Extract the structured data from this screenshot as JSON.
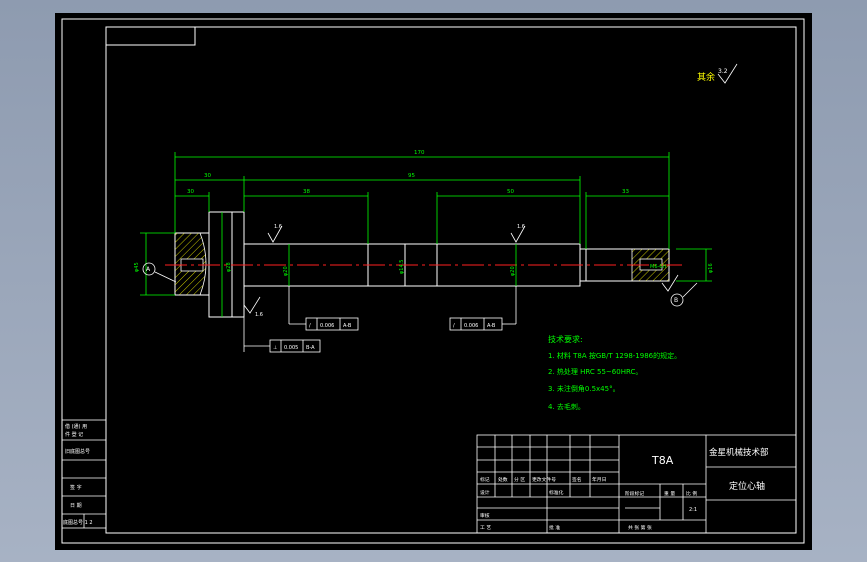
{
  "colors": {
    "background": "#8e9bb0",
    "paper": "#000000",
    "frame": "#ffffff",
    "geometry": "#ffffff",
    "dimension": "#00ff00",
    "centerline": "#ff2020",
    "hatch": "#ffff00",
    "text": "#ffffff",
    "annotation_text": "#00ff00"
  },
  "dimensions": {
    "overall_length": "170",
    "left_end": "30",
    "left_journal": "38",
    "middle_span": "95",
    "right_journal": "50",
    "right_end": "33"
  },
  "annotations": {
    "surface_finish_rest": "其余",
    "roughness_a": "3.2",
    "roughness_b": "1.6",
    "roughness_c": "1.6",
    "roughness_d": "1.6",
    "tolerance_1_value": "0.006",
    "tolerance_1_datum": "A-B",
    "tolerance_2_value": "0.006",
    "tolerance_2_datum": "A-B",
    "tolerance_3_value": "0.005",
    "tolerance_3_datum": "B-A",
    "datum_a": "A",
    "datum_b": "B",
    "dia_left": "φ45",
    "dia_flange": "φ28",
    "dia_journal_1": "φ20",
    "dia_mid": "φ14.5",
    "dia_journal_2": "φ20",
    "dia_end": "φ16",
    "center_hole": "M6-6H"
  },
  "tech_requirements": {
    "heading": "技术要求:",
    "items": [
      "1. 材料 T8A 按GB/T 1298-1986的规定。",
      "2. 热处理 HRC 55~60HRC。",
      "3. 未注倒角0.5x45°。",
      "4. 去毛刺。"
    ]
  },
  "left_stamp": {
    "rows": [
      "借 (通) 用",
      "件 登 记",
      "旧底图总号",
      "签 字",
      "日 期",
      "底图总号  1  2"
    ]
  },
  "title_block": {
    "material": "T8A",
    "company": "金星机械技术部",
    "part_name": "定位心轴",
    "scale": "2:1",
    "labels": {
      "mark": "标记",
      "count": "处数",
      "zone": "分 区",
      "change_doc": "更改文件号",
      "signature": "签名",
      "date": "年月日",
      "design": "设计",
      "standardize": "标准化",
      "stage_mark": "阶段标记",
      "weight": "重 量",
      "ratio": "比 例",
      "review": "审核",
      "process": "工 艺",
      "approve": "批 准",
      "sheets": "共  张  第  张"
    }
  }
}
